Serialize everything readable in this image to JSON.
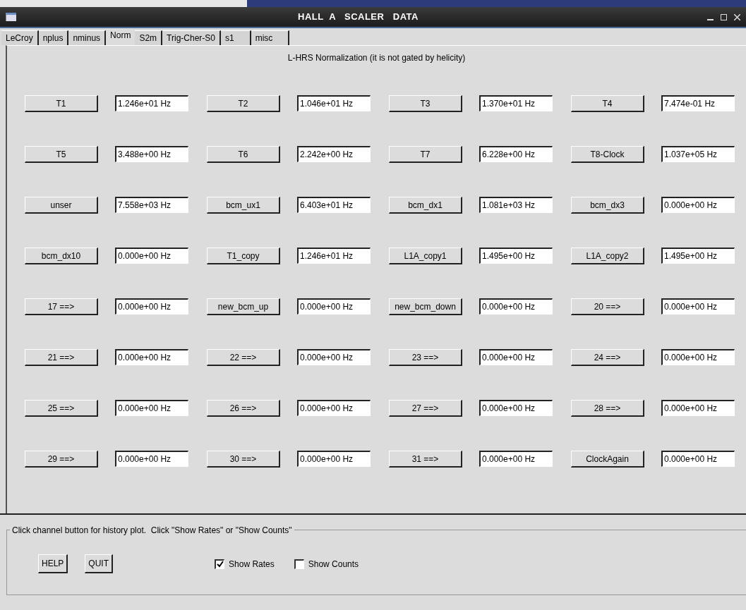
{
  "window": {
    "title": "HALL  A   SCALER   DATA"
  },
  "tabs": [
    {
      "label": "LeCroy",
      "selected": false
    },
    {
      "label": "nplus",
      "selected": false
    },
    {
      "label": "nminus",
      "selected": false
    },
    {
      "label": "Norm",
      "selected": true
    },
    {
      "label": "S2m",
      "selected": false
    },
    {
      "label": "Trig-Cher-S0",
      "selected": false
    },
    {
      "label": "s1",
      "selected": false
    },
    {
      "label": "misc",
      "selected": false
    }
  ],
  "heading": "L-HRS Normalization (it is not gated by helicity)",
  "channels": [
    {
      "label": "T1",
      "value": "1.246e+01 Hz"
    },
    {
      "label": "T2",
      "value": "1.046e+01 Hz"
    },
    {
      "label": "T3",
      "value": "1.370e+01 Hz"
    },
    {
      "label": "T4",
      "value": "7.474e-01 Hz"
    },
    {
      "label": "T5",
      "value": "3.488e+00 Hz"
    },
    {
      "label": "T6",
      "value": "2.242e+00 Hz"
    },
    {
      "label": "T7",
      "value": "6.228e+00 Hz"
    },
    {
      "label": "T8-Clock",
      "value": "1.037e+05 Hz"
    },
    {
      "label": "unser",
      "value": "7.558e+03 Hz"
    },
    {
      "label": "bcm_ux1",
      "value": "6.403e+01 Hz"
    },
    {
      "label": "bcm_dx1",
      "value": "1.081e+03 Hz"
    },
    {
      "label": "bcm_dx3",
      "value": "0.000e+00 Hz"
    },
    {
      "label": "bcm_dx10",
      "value": "0.000e+00 Hz"
    },
    {
      "label": "T1_copy",
      "value": "1.246e+01 Hz"
    },
    {
      "label": "L1A_copy1",
      "value": "1.495e+00 Hz"
    },
    {
      "label": "L1A_copy2",
      "value": "1.495e+00 Hz"
    },
    {
      "label": "17 ==>",
      "value": "0.000e+00 Hz"
    },
    {
      "label": "new_bcm_up",
      "value": "0.000e+00 Hz"
    },
    {
      "label": "new_bcm_down",
      "value": "0.000e+00 Hz"
    },
    {
      "label": "20 ==>",
      "value": "0.000e+00 Hz"
    },
    {
      "label": "21 ==>",
      "value": "0.000e+00 Hz"
    },
    {
      "label": "22 ==>",
      "value": "0.000e+00 Hz"
    },
    {
      "label": "23 ==>",
      "value": "0.000e+00 Hz"
    },
    {
      "label": "24 ==>",
      "value": "0.000e+00 Hz"
    },
    {
      "label": "25 ==>",
      "value": "0.000e+00 Hz"
    },
    {
      "label": "26 ==>",
      "value": "0.000e+00 Hz"
    },
    {
      "label": "27 ==>",
      "value": "0.000e+00 Hz"
    },
    {
      "label": "28 ==>",
      "value": "0.000e+00 Hz"
    },
    {
      "label": "29 ==>",
      "value": "0.000e+00 Hz"
    },
    {
      "label": "30 ==>",
      "value": "0.000e+00 Hz"
    },
    {
      "label": "31 ==>",
      "value": "0.000e+00 Hz"
    },
    {
      "label": "ClockAgain",
      "value": "0.000e+00 Hz"
    }
  ],
  "footer": {
    "legend": "Click channel button for history plot.  Click \"Show Rates\" or \"Show Counts\"",
    "buttons": [
      "HELP",
      "QUIT"
    ],
    "checkboxes": [
      {
        "label": "Show Rates",
        "checked": true
      },
      {
        "label": "Show Counts",
        "checked": false
      }
    ]
  }
}
